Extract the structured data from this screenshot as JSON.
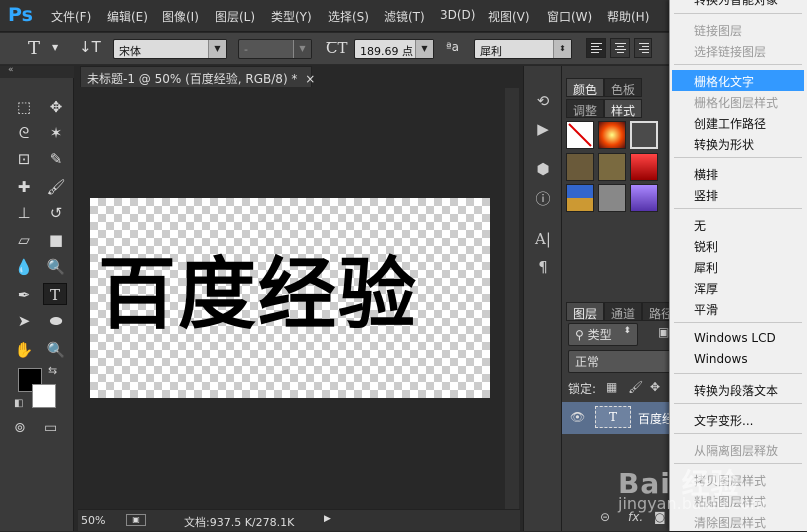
{
  "app": {
    "logo": "Ps"
  },
  "menu": [
    "文件(F)",
    "编辑(E)",
    "图像(I)",
    "图层(L)",
    "类型(Y)",
    "选择(S)",
    "滤镜(T)",
    "3D(D)",
    "视图(V)",
    "窗口(W)",
    "帮助(H)"
  ],
  "options": {
    "font_family": "宋体",
    "font_style": "-",
    "font_size": "189.69 点",
    "aa_label": "ªa",
    "anti_alias": "犀利"
  },
  "document": {
    "tab_title": "未标题-1 @ 50% (百度经验, RGB/8) *",
    "close": "×",
    "canvas_text": "百度经验",
    "zoom": "50%",
    "doc_info": "文档:937.5 K/278.1K"
  },
  "panels": {
    "tabs_top": [
      "颜色",
      "色板"
    ],
    "tabs_mid": [
      "调整",
      "样式"
    ],
    "tabs_layers": [
      "图层",
      "通道",
      "路径"
    ],
    "layer_kind": "类型",
    "blend_mode": "正常",
    "lock_label": "锁定:",
    "layer_name": "百度经验",
    "layer_thumb": "T"
  },
  "context_menu": {
    "items": [
      {
        "label": "转换为智能对象",
        "disabled": false
      },
      {
        "label": "链接图层",
        "disabled": true
      },
      {
        "label": "选择链接图层",
        "disabled": true
      },
      {
        "label": "栅格化文字",
        "disabled": false,
        "highlight": true
      },
      {
        "label": "栅格化图层样式",
        "disabled": true
      },
      {
        "label": "创建工作路径",
        "disabled": false
      },
      {
        "label": "转换为形状",
        "disabled": false
      },
      {
        "label": "横排",
        "disabled": false
      },
      {
        "label": "竖排",
        "disabled": false
      },
      {
        "label": "无",
        "disabled": false
      },
      {
        "label": "锐利",
        "disabled": false
      },
      {
        "label": "犀利",
        "disabled": false
      },
      {
        "label": "浑厚",
        "disabled": false
      },
      {
        "label": "平滑",
        "disabled": false
      },
      {
        "label": "Windows LCD",
        "disabled": false
      },
      {
        "label": "Windows",
        "disabled": false
      },
      {
        "label": "转换为段落文本",
        "disabled": false
      },
      {
        "label": "文字变形...",
        "disabled": false
      },
      {
        "label": "从隔离图层释放",
        "disabled": true
      },
      {
        "label": "拷贝图层样式",
        "disabled": true
      },
      {
        "label": "粘贴图层样式",
        "disabled": true
      },
      {
        "label": "清除图层样式",
        "disabled": true
      }
    ]
  },
  "watermark": {
    "brand": "Bai 经验",
    "url": "jingyan.baidu.com"
  },
  "colors": {
    "highlight": "#3399ff",
    "ps_blue": "#31a8ff"
  }
}
